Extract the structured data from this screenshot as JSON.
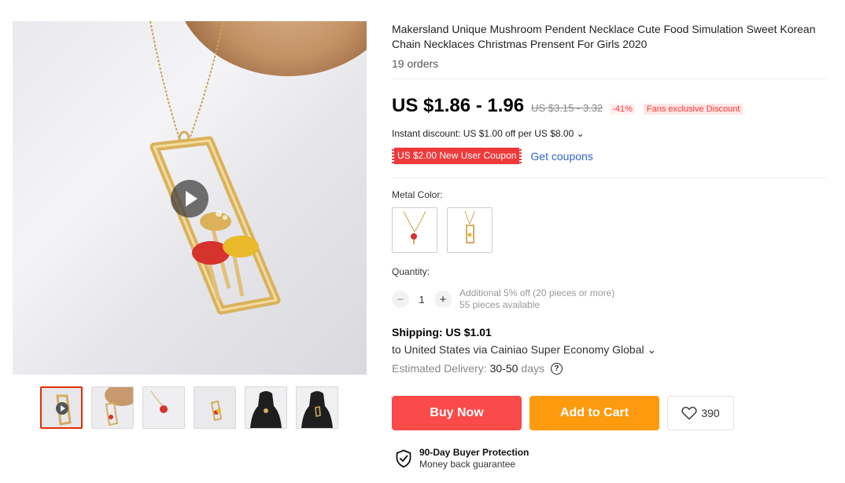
{
  "product": {
    "title": "Makersland Unique Mushroom Pendent Necklace Cute Food Simulation Sweet Korean Chain Necklaces Christmas Prensent For Girls 2020",
    "orders": "19 orders"
  },
  "price": {
    "current": "US $1.86 - 1.96",
    "original": "US $3.15 - 3.32",
    "discount": "-41%",
    "fans_badge": "Fans exclusive Discount"
  },
  "instant_discount": "Instant discount: US $1.00 off per US $8.00 ⌄",
  "coupon": {
    "tag": "US $2.00 New User Coupon",
    "link": "Get coupons"
  },
  "sku": {
    "label": "Metal Color:",
    "options": [
      "red mushroom pendant",
      "rectangle mushroom pendant"
    ]
  },
  "quantity": {
    "label": "Quantity:",
    "minus": "−",
    "value": "1",
    "plus": "+",
    "note_line1": "Additional 5% off (20 pieces or more)",
    "note_line2": "55 pieces available"
  },
  "shipping": {
    "title": "Shipping: US $1.01",
    "route": "to United States via Cainiao Super Economy Global ⌄",
    "delivery_label": "Estimated Delivery:",
    "delivery_days": "30-50",
    "delivery_unit": "days",
    "help_icon": "?"
  },
  "actions": {
    "buy_now": "Buy Now",
    "add_to_cart": "Add to Cart",
    "wishlist_count": "390"
  },
  "protection": {
    "title": "90-Day Buyer Protection",
    "subtitle": "Money back guarantee"
  },
  "colors": {
    "buy": "#fa4a4a",
    "cart": "#fe9a0e",
    "coupon": "#ef3a3a",
    "link": "#2e68c7"
  }
}
